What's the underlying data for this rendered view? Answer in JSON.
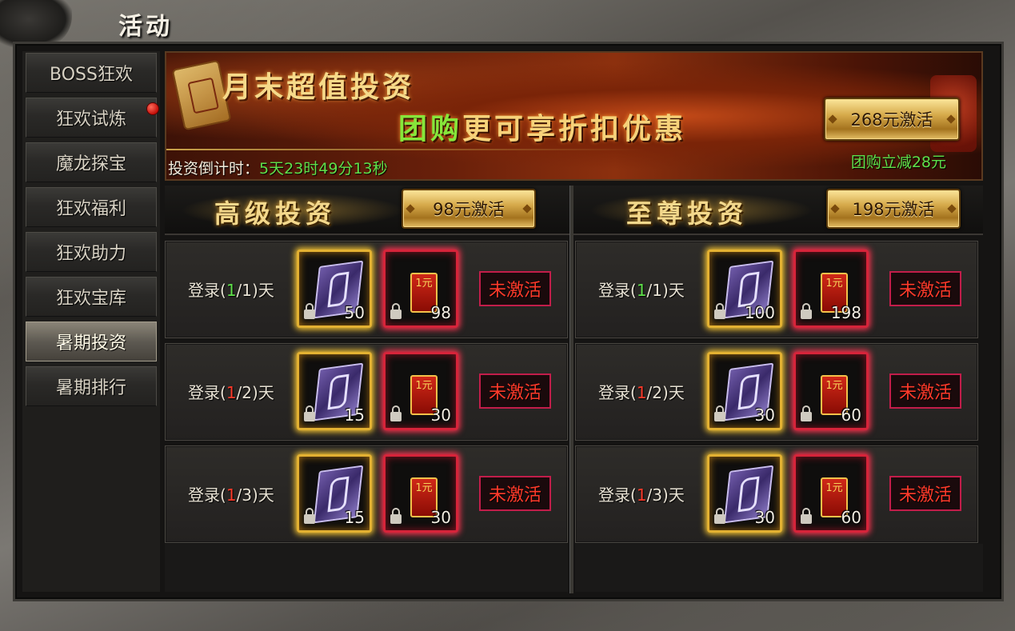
{
  "window": {
    "title": "活动"
  },
  "sidebar": {
    "items": [
      {
        "label": "BOSS狂欢",
        "active": false,
        "badge": false
      },
      {
        "label": "狂欢试炼",
        "active": false,
        "badge": true
      },
      {
        "label": "魔龙探宝",
        "active": false,
        "badge": false
      },
      {
        "label": "狂欢福利",
        "active": false,
        "badge": false
      },
      {
        "label": "狂欢助力",
        "active": false,
        "badge": false
      },
      {
        "label": "狂欢宝库",
        "active": false,
        "badge": false
      },
      {
        "label": "暑期投资",
        "active": true,
        "badge": false
      },
      {
        "label": "暑期排行",
        "active": false,
        "badge": false
      }
    ]
  },
  "banner": {
    "title": "月末超值投资",
    "subtitle_green": "团购",
    "subtitle_gold": "更可享折扣优惠",
    "countdown_label": "投资倒计时：",
    "countdown_value": "5天23时49分13秒",
    "activate_button": "268元激活",
    "discount_text": "团购立减28元"
  },
  "columns": [
    {
      "title": "高级投资",
      "button": "98元激活",
      "rows": [
        {
          "prefix": "登录(",
          "current": "1",
          "current_color": "green",
          "suffix": "/1)天",
          "item1_qty": "50",
          "item2_qty": "98",
          "status": "未激活"
        },
        {
          "prefix": "登录(",
          "current": "1",
          "current_color": "red",
          "suffix": "/2)天",
          "item1_qty": "15",
          "item2_qty": "30",
          "status": "未激活"
        },
        {
          "prefix": "登录(",
          "current": "1",
          "current_color": "red",
          "suffix": "/3)天",
          "item1_qty": "15",
          "item2_qty": "30",
          "status": "未激活"
        }
      ]
    },
    {
      "title": "至尊投资",
      "button": "198元激活",
      "rows": [
        {
          "prefix": "登录(",
          "current": "1",
          "current_color": "green",
          "suffix": "/1)天",
          "item1_qty": "100",
          "item2_qty": "198",
          "status": "未激活"
        },
        {
          "prefix": "登录(",
          "current": "1",
          "current_color": "red",
          "suffix": "/2)天",
          "item1_qty": "30",
          "item2_qty": "60",
          "status": "未激活"
        },
        {
          "prefix": "登录(",
          "current": "1",
          "current_color": "red",
          "suffix": "/3)天",
          "item1_qty": "30",
          "item2_qty": "60",
          "status": "未激活"
        }
      ]
    }
  ],
  "envelope_label": "1元"
}
